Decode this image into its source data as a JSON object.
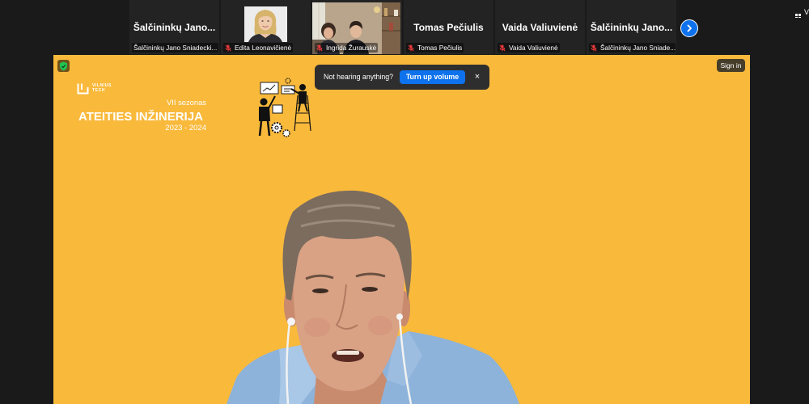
{
  "participant_strip": {
    "tiles": [
      {
        "display_name": "Šalčininkų Jano...",
        "label": "Šalčininkų Jano Sniadecki...",
        "muted": false,
        "video_on": false
      },
      {
        "label": "Edita Leonavičienė",
        "muted": true,
        "video_on": true
      },
      {
        "label": "Ingrida Žurauskė",
        "muted": true,
        "video_on": true
      },
      {
        "display_name": "Tomas Pečiulis",
        "label": "Tomas Pečiulis",
        "muted": true,
        "video_on": false
      },
      {
        "display_name": "Vaida Valiuvienė",
        "label": "Vaida Valiuvienė",
        "muted": true,
        "video_on": false
      },
      {
        "display_name": "Šalčininkų Jano...",
        "label": "Šalčininkų Jano Sniade...",
        "muted": true,
        "video_on": false
      }
    ],
    "muted_icon": "mic-muted-icon",
    "next_page_icon": "chevron-right-icon"
  },
  "view_menu": {
    "icon": "grid-icon",
    "label": "V"
  },
  "active_speaker": {
    "security_icon": "shield-icon",
    "sign_in_label": "Sign in",
    "audio_toast": {
      "message": "Not hearing anything?",
      "action_label": "Turn up volume",
      "close_label": "×"
    },
    "background": {
      "logo_line1": "VILNIUS",
      "logo_line2": "TECH",
      "season": "VII sezonas",
      "title": "ATEITIES INŽINERIJA",
      "years": "2023 - 2024"
    }
  },
  "colors": {
    "app_background": "#1a1a1a",
    "tile_background": "#232323",
    "virtual_background": "#f9b93b",
    "accent_blue": "#0e72ed",
    "muted_red": "#e5393b",
    "secure_green": "#23c552"
  }
}
